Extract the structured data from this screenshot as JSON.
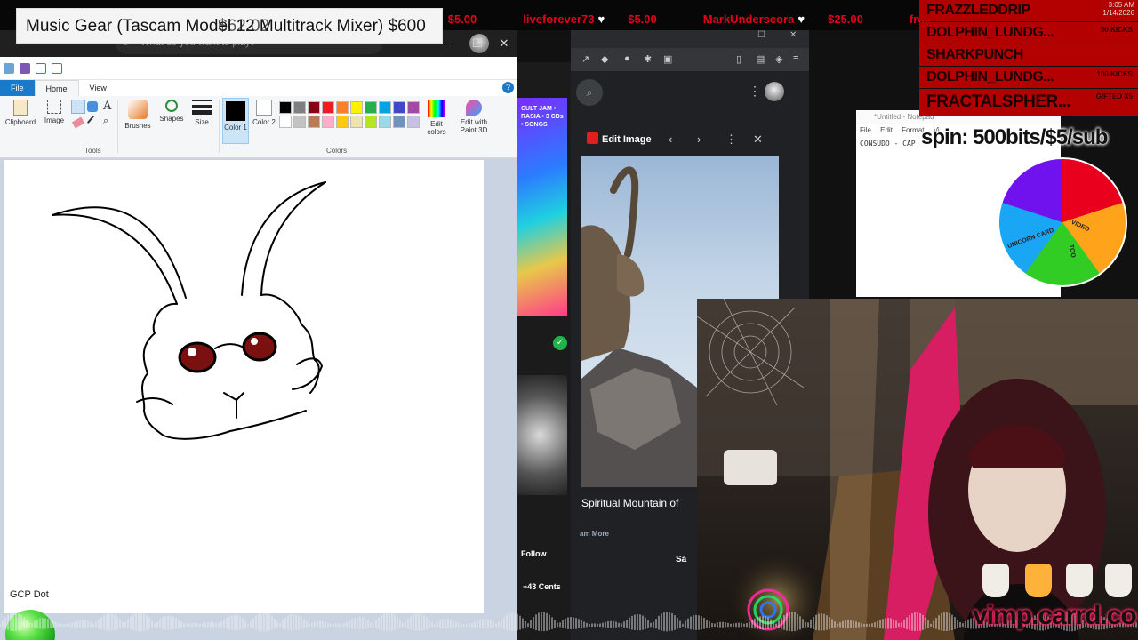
{
  "ticker": {
    "items": [
      {
        "amount": "$5.00"
      },
      {
        "name": "liveforever73",
        "amount": "$5.00"
      },
      {
        "name": "MarkUnderscora",
        "amount": "$25.00"
      },
      {
        "name": "froi"
      }
    ]
  },
  "goal": {
    "text": "Music Gear (Tascam Model 12 Multitrack Mixer) $600",
    "overlay_amount": "$62.02"
  },
  "paint": {
    "search_placeholder": "What do you want to play?",
    "tabs": [
      "File",
      "Home",
      "View"
    ],
    "tools": {
      "clipboard": "Clipboard",
      "image": "Image",
      "tools": "Tools",
      "brushes": "Brushes",
      "shapes": "Shapes",
      "size": "Size",
      "color1": "Color 1",
      "color2": "Color 2",
      "colors": "Colors",
      "edit_colors": "Edit colors",
      "edit_with_3d": "Edit with Paint 3D"
    },
    "palette": [
      "#000000",
      "#7f7f7f",
      "#880015",
      "#ed1c24",
      "#ff7f27",
      "#fff200",
      "#22b14c",
      "#00a2e8",
      "#3f48cc",
      "#a349a4",
      "#ffffff",
      "#c3c3c3",
      "#b97a57",
      "#ffaec9",
      "#ffc90e",
      "#efe4b0",
      "#b5e61d",
      "#99d9ea",
      "#7092be",
      "#c8bfe7"
    ]
  },
  "gcp": {
    "label": "GCP Dot"
  },
  "strip": {
    "art_text": "CULT JAM • RASIA • 3 CDs • SONGS",
    "follow": "Follow",
    "cents": "+43 Cents"
  },
  "viewer": {
    "edit_image": "Edit Image",
    "caption": "Spiritual Mountain of",
    "learn_more": "am More",
    "sa": "Sa"
  },
  "notepad": {
    "title": "*Untitled - Notepad",
    "menu": [
      "File",
      "Edit",
      "Format",
      "Vi"
    ],
    "content": "CONSUDO - CAP"
  },
  "subs": [
    {
      "name": "FRAZZLEDDRIP",
      "detail": ""
    },
    {
      "name": "DOLPHIN_LUNDG...",
      "detail": "50 KICKS"
    },
    {
      "name": "SHARKPUNCH",
      "detail": ""
    },
    {
      "name": "DOLPHIN_LUNDG...",
      "detail": "100 KICKS"
    },
    {
      "name": "FRACTALSPHER...",
      "detail": "GIFTED X5"
    }
  ],
  "clock": {
    "time": "3:05 AM",
    "date": "1/14/2026"
  },
  "spin": {
    "text": "spin: 500bits/$5/sub"
  },
  "wheel": {
    "labels": [
      "VIDEO",
      "UNICORN CARD",
      "TOO"
    ]
  },
  "watermark": {
    "text": "vimp.carrd.co"
  }
}
